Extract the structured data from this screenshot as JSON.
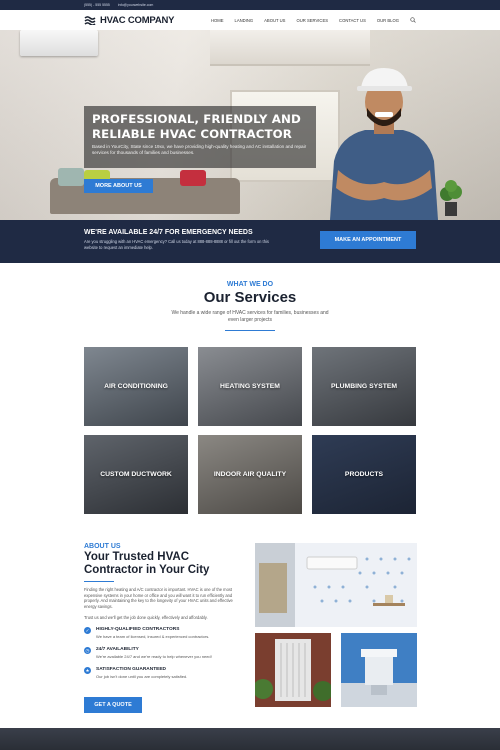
{
  "topbar": {
    "phone": "(555) - 555 5555",
    "email": "info@yourwebsite.com"
  },
  "header": {
    "logo_text": "HVAC COMPANY",
    "nav": [
      "HOME",
      "LANDING",
      "ABOUT US",
      "OUR SERVICES",
      "CONTACT US",
      "OUR BLOG"
    ]
  },
  "hero": {
    "title": "PROFESSIONAL, FRIENDLY AND RELIABLE HVAC CONTRACTOR",
    "body": "Based in YourCity, State since 19xx, we have providing high-quality heating and AC installation and repair services for thousands of families and businesses.",
    "button": "MORE ABOUT US"
  },
  "emergency": {
    "title": "WE'RE AVAILABLE 24/7 FOR EMERGENCY NEEDS",
    "body": "Are you struggling with an HVAC emergency? Call us today at 888-888-8888 or fill out the form on this website to request an immediate help.",
    "button": "MAKE AN APPOINTMENT"
  },
  "services": {
    "kicker": "WHAT WE DO",
    "title": "Our Services",
    "subtitle": "We handle a wide range of HVAC services for families, businesses and even larger projects",
    "cards": [
      {
        "label": "AIR CONDITIONING"
      },
      {
        "label": "HEATING SYSTEM"
      },
      {
        "label": "PLUMBING SYSTEM"
      },
      {
        "label": "CUSTOM DUCTWORK"
      },
      {
        "label": "INDOOR AIR QUALITY"
      },
      {
        "label": "PRODUCTS"
      }
    ]
  },
  "about": {
    "kicker": "ABOUT US",
    "title": "Your Trusted HVAC Contractor in Your City",
    "intro": "Finding the right heating and A/C contractor is important. HVAC is one of the most expensive systems in your home or office and you will want it to run efficiently and properly. And maintaining the key to the longevity of your HVAC units and effective energy savings.",
    "intro2": "Trust us and we'll get the job done quickly, effectively and affordably.",
    "features": [
      {
        "title": "HIGHLY-QUALIFIED CONTRACTORS",
        "desc": "We have a team of licensed, insured & experienced contractors."
      },
      {
        "title": "24/7 AVAILABILITY",
        "desc": "We're available 24/7 and we're ready to help whenever you need!"
      },
      {
        "title": "SATISFACTION GUARANTEED",
        "desc": "Our job isn't done until you are completely satisfied."
      }
    ],
    "button": "GET A QUOTE"
  }
}
